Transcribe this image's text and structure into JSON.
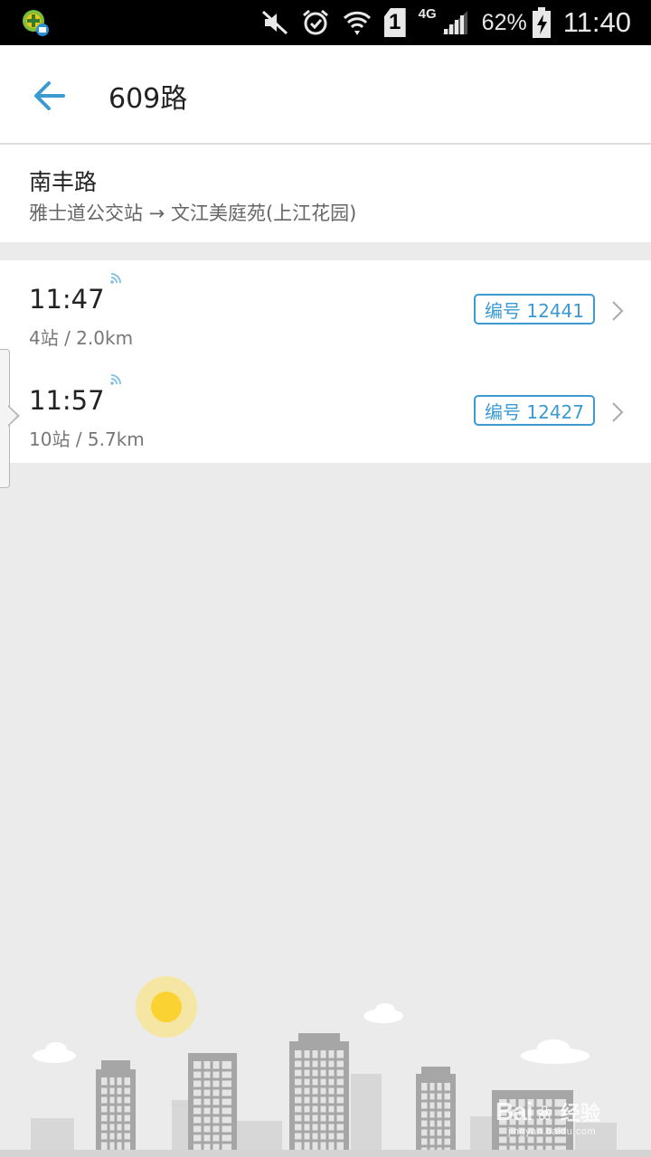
{
  "status_bar": {
    "network_type": "4G",
    "sim_slot": "1",
    "battery": "62%",
    "time": "11:40",
    "icons": [
      "app-notification-icon",
      "mute-icon",
      "alarm-icon",
      "wifi-icon",
      "sim-icon",
      "signal-icon",
      "battery-charging-icon"
    ]
  },
  "header": {
    "title": "609路",
    "back_icon": "back-arrow-icon"
  },
  "stop": {
    "name": "南丰路",
    "direction": "雅士道公交站 → 文江美庭苑(上江花园)"
  },
  "buses": [
    {
      "arrival_time": "11:47",
      "info": "4站 / 2.0km",
      "plate": "编号 12441",
      "realtime_icon": "realtime-signal-icon"
    },
    {
      "arrival_time": "11:57",
      "info": "10站 / 5.7km",
      "plate": "编号 12427",
      "realtime_icon": "realtime-signal-icon"
    }
  ],
  "watermark": {
    "logo_text": "Bai",
    "logo_suffix": "经验",
    "url": "jingyan.baidu.com"
  },
  "colors": {
    "accent": "#3b9bd1",
    "background": "#ebebeb",
    "sun": "#fad232",
    "buildings": "#a6a6a6"
  }
}
